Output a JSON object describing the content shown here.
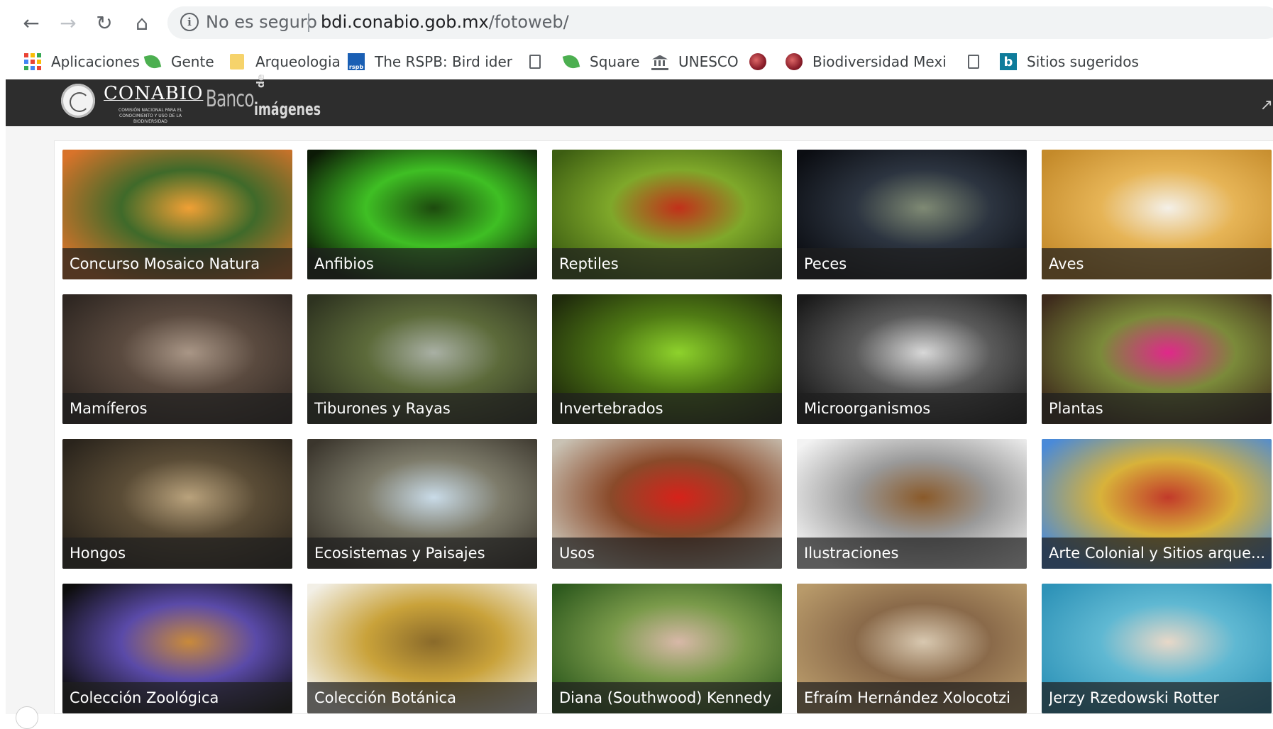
{
  "browser": {
    "security_label": "No es seguro",
    "url_host": "bdi.conabio.gob.mx",
    "url_path": "/fotoweb/"
  },
  "bookmarks": [
    {
      "label": "Aplicaciones",
      "icon": "apps-grid-icon"
    },
    {
      "label": "Gente",
      "icon": "leaf-icon"
    },
    {
      "label": "Arqueologia",
      "icon": "folder-icon"
    },
    {
      "label": "The RSPB: Bird identi",
      "icon": "rspb-icon"
    },
    {
      "label": "",
      "icon": "page-icon"
    },
    {
      "label": "Square",
      "icon": "leaf-icon"
    },
    {
      "label": "UNESCO",
      "icon": "museum-icon"
    },
    {
      "label": "",
      "icon": "globe-icon"
    },
    {
      "label": "Biodiversidad Mexica",
      "icon": "globe-icon"
    },
    {
      "label": "",
      "icon": "page-icon"
    },
    {
      "label": "Sitios sugeridos",
      "icon": "bing-icon"
    }
  ],
  "site": {
    "logo_name": "CONABIO",
    "logo_subtitle": "COMISIÓN NACIONAL PARA EL CONOCIMIENTO Y USO DE LA BIODIVERSIDAD",
    "banco": "Banco",
    "de": "de",
    "imagenes": "imágenes"
  },
  "categories": [
    {
      "label": "Concurso Mosaico Natura",
      "colors": [
        "#d8732a",
        "#3f6a2a",
        "#f0a035"
      ]
    },
    {
      "label": "Anfibios",
      "colors": [
        "#0c1a06",
        "#3fbf24",
        "#1d4a0e"
      ]
    },
    {
      "label": "Reptiles",
      "colors": [
        "#3d5e12",
        "#7fa82a",
        "#c2301a"
      ]
    },
    {
      "label": "Peces",
      "colors": [
        "#0b0d12",
        "#2c3440",
        "#7f8a74"
      ]
    },
    {
      "label": "Aves",
      "colors": [
        "#c48a2a",
        "#e6b456",
        "#f4f0e8"
      ]
    },
    {
      "label": "Mamíferos",
      "colors": [
        "#2f2722",
        "#5a4a3f",
        "#a99686"
      ]
    },
    {
      "label": "Tiburones y Rayas",
      "colors": [
        "#2e3320",
        "#5c6a3a",
        "#a9b0a4"
      ]
    },
    {
      "label": "Invertebrados",
      "colors": [
        "#1f2a0c",
        "#4f7a14",
        "#8ed22c"
      ]
    },
    {
      "label": "Microorganismos",
      "colors": [
        "#1a1a1a",
        "#5a5a5a",
        "#d8d8d8"
      ]
    },
    {
      "label": "Plantas",
      "colors": [
        "#3e2b1c",
        "#7b8a3a",
        "#e0288a"
      ]
    },
    {
      "label": "Hongos",
      "colors": [
        "#2a241c",
        "#5a4c36",
        "#b9a27c"
      ]
    },
    {
      "label": "Ecosistemas y Paisajes",
      "colors": [
        "#3b362d",
        "#7d7b6a",
        "#c9dbe8"
      ]
    },
    {
      "label": "Usos",
      "colors": [
        "#c9c2b4",
        "#8a4a2a",
        "#d6221a"
      ]
    },
    {
      "label": "Ilustraciones",
      "colors": [
        "#f3f3f3",
        "#9a9a9a",
        "#8a5a2a"
      ]
    },
    {
      "label": "Arte Colonial y Sitios arque...",
      "colors": [
        "#4a8ad8",
        "#d8b23a",
        "#c23a2a"
      ]
    },
    {
      "label": "Colección Zoológica",
      "colors": [
        "#0d0d0d",
        "#5a4aa8",
        "#c98a3a"
      ]
    },
    {
      "label": "Colección Botánica",
      "colors": [
        "#f2efe6",
        "#c9a23a",
        "#8a6a2a"
      ]
    },
    {
      "label": "Diana (Southwood) Kennedy",
      "colors": [
        "#2e5a1e",
        "#7a9a4a",
        "#d8b8a8"
      ]
    },
    {
      "label": "Efraím Hernández Xolocotzi",
      "colors": [
        "#b89a6a",
        "#8a6a4a",
        "#d8c8b0"
      ]
    },
    {
      "label": "Jerzy Rzedowski Rotter",
      "colors": [
        "#2e93b8",
        "#5fb8d2",
        "#e8d8c8"
      ]
    }
  ]
}
